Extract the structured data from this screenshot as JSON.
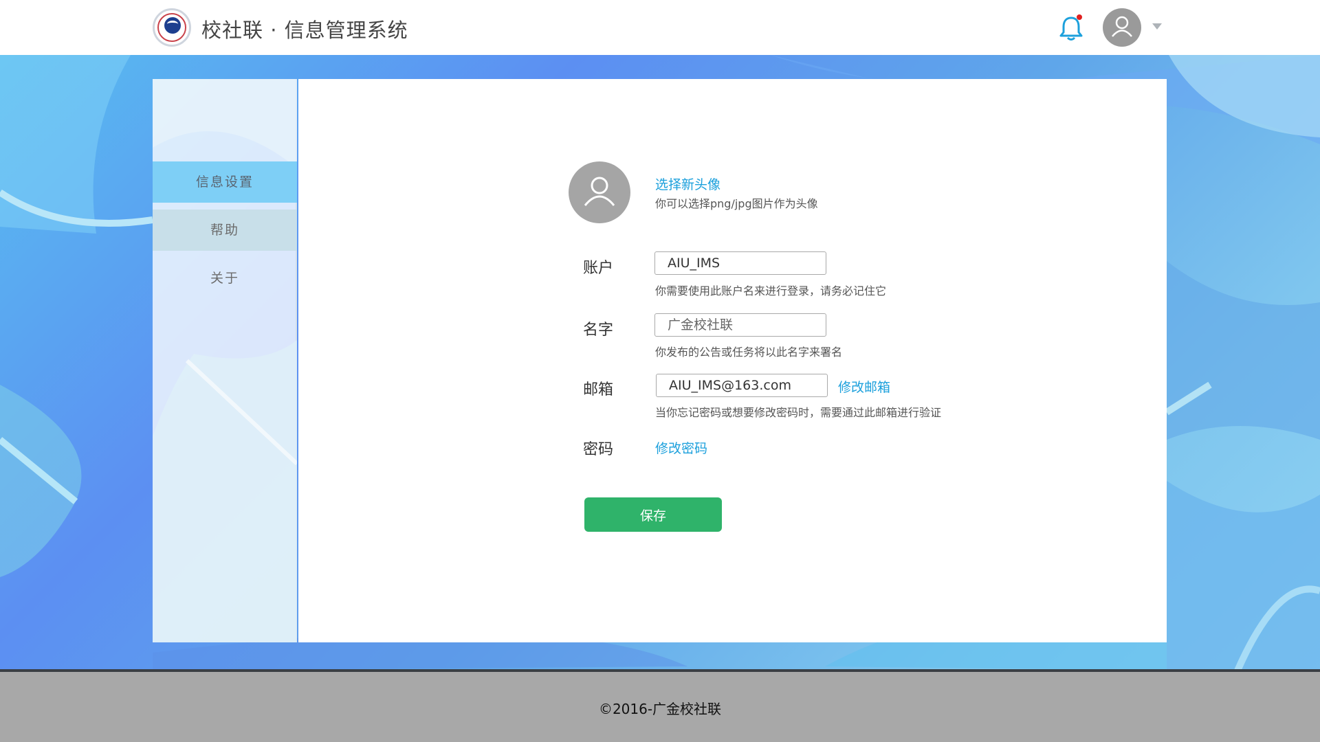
{
  "header": {
    "title": "校社联 · 信息管理系统",
    "notification_dot_color": "#e02020",
    "bell_color": "#1ca0dc"
  },
  "sidebar": {
    "items": [
      {
        "label": "信息设置",
        "active": true
      },
      {
        "label": "帮助",
        "active": false
      },
      {
        "label": "关于",
        "active": false
      }
    ]
  },
  "profile": {
    "choose_avatar_label": "选择新头像",
    "avatar_hint": "你可以选择png/jpg图片作为头像",
    "account": {
      "label": "账户",
      "value": "AIU_IMS",
      "hint": "你需要使用此账户名来进行登录，请务必记住它"
    },
    "name": {
      "label": "名字",
      "placeholder": "广金校社联",
      "hint": "你发布的公告或任务将以此名字来署名"
    },
    "email": {
      "label": "邮箱",
      "value": "AIU_IMS@163.com",
      "change_label": "修改邮箱",
      "hint": "当你忘记密码或想要修改密码时，需要通过此邮箱进行验证"
    },
    "password": {
      "label": "密码",
      "change_label": "修改密码"
    },
    "save_label": "保存"
  },
  "footer": {
    "copyright": "©2016-广金校社联"
  },
  "colors": {
    "accent": "#1ca0dc",
    "save_button": "#2fb36a",
    "sidebar_active": "#7ecff6"
  }
}
